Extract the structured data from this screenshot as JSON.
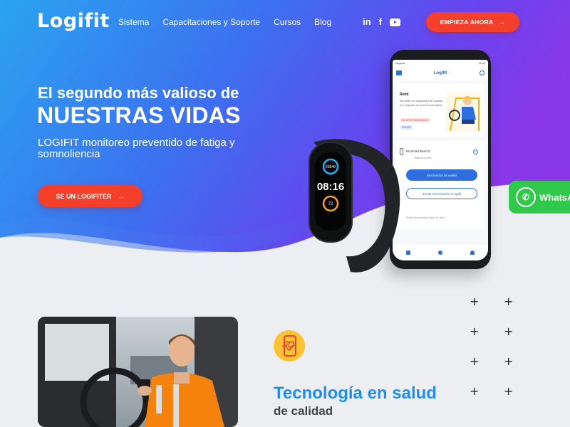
{
  "brand": {
    "logo": "Logifit"
  },
  "nav": {
    "items": [
      "Sistema",
      "Capacitaciones y Soporte",
      "Cursos",
      "Blog"
    ]
  },
  "social": {
    "linkedin": "in",
    "facebook": "f"
  },
  "header": {
    "cta_label": "EMPIEZA AHORA",
    "arrow": "→"
  },
  "hero": {
    "title_line1": "El segundo más valioso de",
    "title_line2": "NUESTRAS VIDAS",
    "subtitle": "LOGIFIT monitoreo preventido de fatiga y somnoliencia",
    "button_label": "SE UN LOGIFITER"
  },
  "watch": {
    "top": "26540",
    "time": "08:16",
    "bottom": "72"
  },
  "phone": {
    "status_left": "Angular",
    "status_right": "13:45",
    "app_title": "Logifit",
    "card_title": "Rodil",
    "card_text": "No estás en capacidad de manejo por régimen de sueño incompleto.",
    "badge_red": "NO APTO PARA MANEJO",
    "badge_blue": "DIURNO",
    "band_name": "Mi Smart Band 5",
    "battery": "Batería al 98%",
    "sync_label": "Sincronizar mi sueño",
    "send_label": "Enviar información a Logifit",
    "synced_label": "Sueño sincronizado hace 7h 3min"
  },
  "whatsapp": {
    "label": "WhatsA"
  },
  "section2": {
    "title": "Tecnología en salud",
    "subtitle": "de calidad"
  },
  "colors": {
    "hero_start": "#2aa4f0",
    "hero_end": "#8a37ea",
    "accent_red": "#f4402b",
    "tech_blue": "#1f8ef1",
    "whatsapp": "#31c94c"
  }
}
